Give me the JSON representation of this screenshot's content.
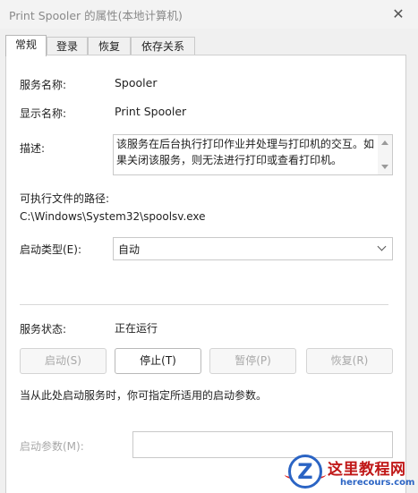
{
  "window": {
    "title": "Print Spooler 的属性(本地计算机)",
    "close_glyph": "✕"
  },
  "tabs": [
    {
      "label": "常规",
      "active": true
    },
    {
      "label": "登录",
      "active": false
    },
    {
      "label": "恢复",
      "active": false
    },
    {
      "label": "依存关系",
      "active": false
    }
  ],
  "general": {
    "service_name_label": "服务名称:",
    "service_name": "Spooler",
    "display_name_label": "显示名称:",
    "display_name": "Print Spooler",
    "description_label": "描述:",
    "description": "该服务在后台执行打印作业并处理与打印机的交互。如果关闭该服务，则无法进行打印或查看打印机。",
    "exe_path_label": "可执行文件的路径:",
    "exe_path": "C:\\Windows\\System32\\spoolsv.exe",
    "startup_type_label": "启动类型(E):",
    "startup_type": "自动",
    "status_label": "服务状态:",
    "status_value": "正在运行",
    "buttons": {
      "start": "启动(S)",
      "stop": "停止(T)",
      "pause": "暂停(P)",
      "resume": "恢复(R)"
    },
    "hint": "当从此处启动服务时，你可指定所适用的启动参数。",
    "start_params_label": "启动参数(M):",
    "start_params_value": ""
  },
  "watermark": {
    "logo_letter": "Z",
    "title": "这里教程网",
    "url": "herecours.com"
  }
}
